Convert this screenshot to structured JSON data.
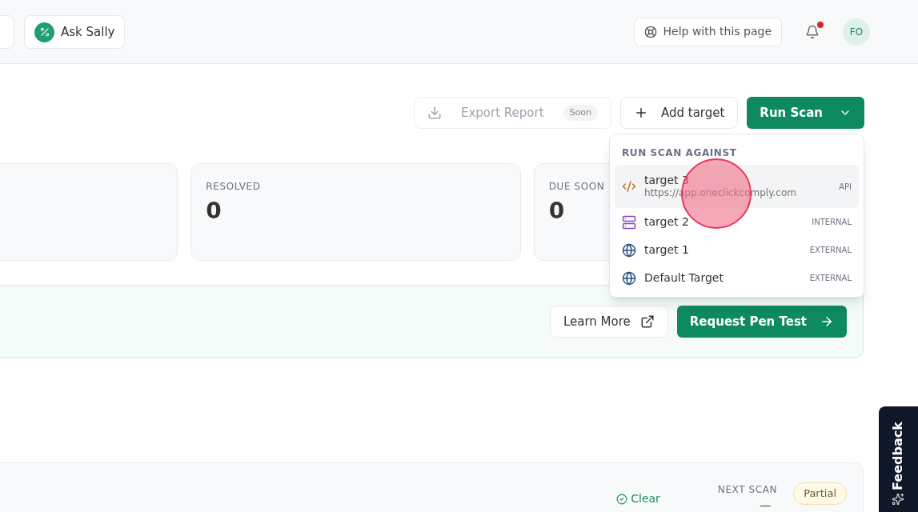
{
  "header": {
    "assistant_button": "Ask Sally",
    "help_button": "Help with this page",
    "notifications": {
      "unread": true
    },
    "avatar": "FO"
  },
  "toolbar": {
    "export": {
      "label": "Export Report",
      "badge": "Soon",
      "disabled": true
    },
    "add_target": "Add target",
    "run_scan": "Run Scan"
  },
  "stats": [
    {
      "label": "RESOLVED",
      "value": "0"
    },
    {
      "label": "DUE SOON",
      "value": "0"
    }
  ],
  "banner": {
    "learn_more": "Learn More",
    "request": "Request Pen Test"
  },
  "scan_card": {
    "status": "Clear",
    "next_scan_label": "NEXT SCAN",
    "next_scan_value": "—",
    "badge": "Partial"
  },
  "dropdown": {
    "heading": "RUN SCAN AGAINST",
    "targets": [
      {
        "name": "target 3",
        "url": "https://app.oneclickcomply.com",
        "type": "API",
        "kind": "api",
        "selected": true
      },
      {
        "name": "target 2",
        "type": "INTERNAL",
        "kind": "internal",
        "selected": false
      },
      {
        "name": "target 1",
        "type": "EXTERNAL",
        "kind": "external",
        "selected": false
      },
      {
        "name": "Default Target",
        "type": "EXTERNAL",
        "kind": "external",
        "selected": false
      }
    ]
  },
  "feedback_tab": "Feedback"
}
